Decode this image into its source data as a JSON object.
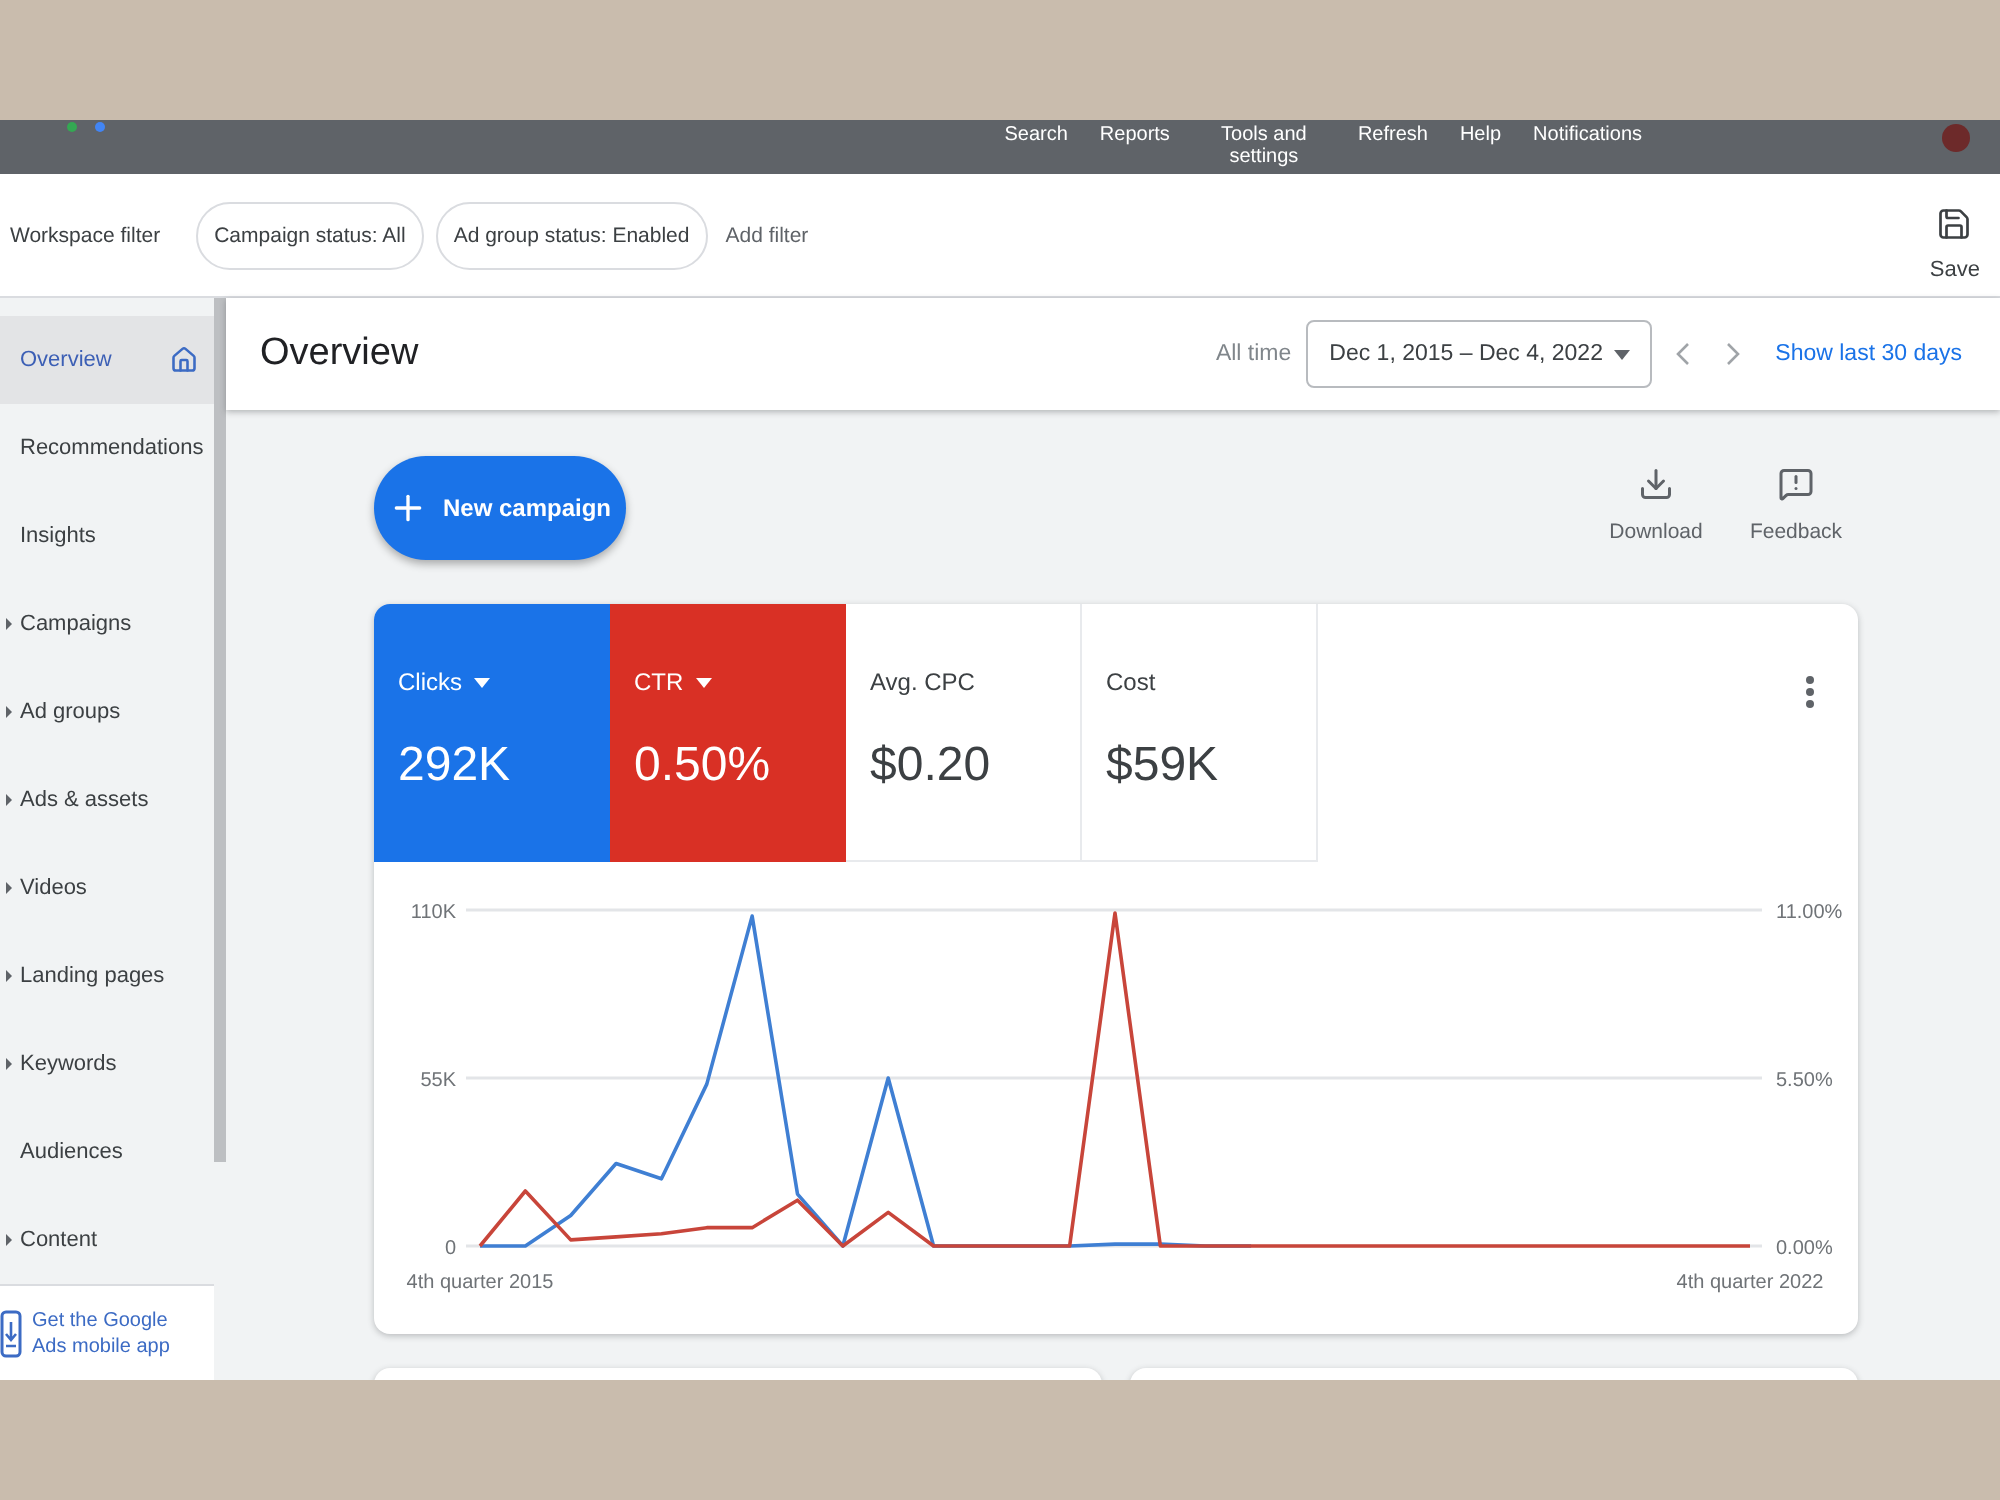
{
  "top_bar": {
    "items": [
      "Search",
      "Reports",
      "Tools and settings",
      "Refresh",
      "Help",
      "Notifications"
    ]
  },
  "filter_bar": {
    "label": "Workspace filter",
    "chips": [
      "Campaign status: All",
      "Ad group status: Enabled"
    ],
    "add_filter": "Add filter",
    "save": "Save"
  },
  "sidebar": {
    "items": [
      {
        "label": "Overview",
        "selected": true,
        "expandable": false,
        "home": true
      },
      {
        "label": "Recommendations",
        "selected": false,
        "expandable": false,
        "home": false
      },
      {
        "label": "Insights",
        "selected": false,
        "expandable": false,
        "home": false
      },
      {
        "label": "Campaigns",
        "selected": false,
        "expandable": true,
        "home": false
      },
      {
        "label": "Ad groups",
        "selected": false,
        "expandable": true,
        "home": false
      },
      {
        "label": "Ads & assets",
        "selected": false,
        "expandable": true,
        "home": false
      },
      {
        "label": "Videos",
        "selected": false,
        "expandable": true,
        "home": false
      },
      {
        "label": "Landing pages",
        "selected": false,
        "expandable": true,
        "home": false
      },
      {
        "label": "Keywords",
        "selected": false,
        "expandable": true,
        "home": false
      },
      {
        "label": "Audiences",
        "selected": false,
        "expandable": false,
        "home": false
      },
      {
        "label": "Content",
        "selected": false,
        "expandable": true,
        "home": false
      }
    ],
    "promo": "Get the Google Ads mobile app"
  },
  "header": {
    "title": "Overview",
    "range_label": "All time",
    "date_range": "Dec 1, 2015 – Dec 4, 2022",
    "link": "Show last 30 days"
  },
  "actions": {
    "new_campaign": "New campaign",
    "tools": [
      {
        "kind": "download",
        "label": "Download"
      },
      {
        "kind": "feedback",
        "label": "Feedback"
      }
    ]
  },
  "metrics": [
    {
      "label": "Clicks",
      "value": "292K",
      "selected": true,
      "color": "#1a73e8"
    },
    {
      "label": "CTR",
      "value": "0.50%",
      "selected": true,
      "color": "#d93025"
    },
    {
      "label": "Avg. CPC",
      "value": "$0.20",
      "selected": false
    },
    {
      "label": "Cost",
      "value": "$59K",
      "selected": false
    }
  ],
  "chart": {
    "chart_data": {
      "type": "line",
      "categories": [
        "4th quarter 2015",
        null,
        null,
        null,
        null,
        null,
        null,
        null,
        null,
        null,
        null,
        null,
        null,
        null,
        null,
        null,
        null,
        null,
        null,
        null,
        null,
        null,
        null,
        null,
        null,
        null,
        null,
        null,
        "4th quarter 2022"
      ],
      "ylim": [
        0,
        110
      ],
      "yticks": [
        {
          "value": 0,
          "label": "0"
        },
        {
          "value": 55,
          "label": "55K"
        },
        {
          "value": 110,
          "label": "110K"
        }
      ],
      "y2lim": [
        0,
        11
      ],
      "y2ticks": [
        {
          "value": 0,
          "label": "0.00%"
        },
        {
          "value": 5.5,
          "label": "5.50%"
        },
        {
          "value": 11,
          "label": "11.00%"
        }
      ],
      "series": [
        {
          "color": "#3f7fd3",
          "values": [
            0,
            0,
            10,
            27,
            22,
            53,
            108,
            17,
            0,
            55,
            0,
            0,
            0,
            0,
            0.6,
            0.6,
            0,
            0,
            null,
            null,
            null,
            null,
            null,
            null,
            null,
            null,
            null,
            null,
            null
          ]
        },
        {
          "color": "#c8453a",
          "axis": "y2",
          "values": [
            0,
            1.8,
            0.2,
            0.3,
            0.4,
            0.6,
            0.6,
            1.5,
            0,
            1.1,
            0,
            0,
            0,
            0,
            10.9,
            0,
            0,
            0,
            0,
            0,
            0,
            0,
            0,
            0,
            0,
            0,
            0,
            0,
            0
          ]
        }
      ]
    }
  }
}
